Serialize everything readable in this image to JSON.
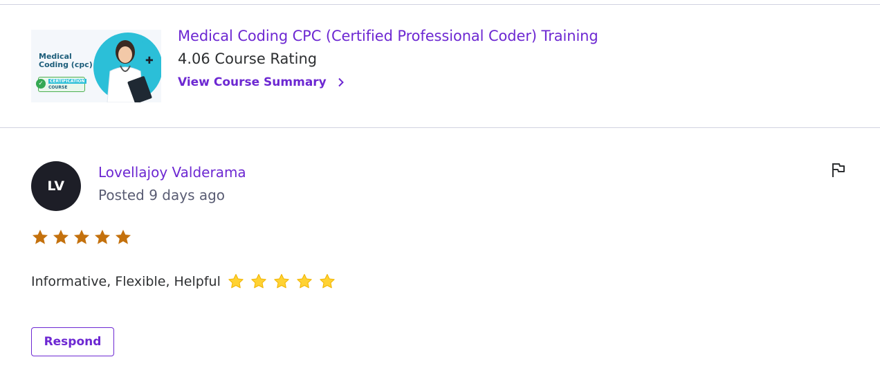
{
  "course": {
    "thumbnail": {
      "title_line1": "Medical",
      "title_line2": "Coding (cpc)",
      "badge_line1": "CERTIFICATION",
      "badge_line2": "COURSE"
    },
    "title": "Medical Coding CPC (Certified Professional Coder) Training",
    "rating_text": "4.06 Course Rating",
    "summary_link": "View Course Summary",
    "summary_icon": "chevron-right-icon"
  },
  "review": {
    "avatar_initials": "LV",
    "reviewer_name": "Lovellajoy Valderama",
    "posted": "Posted 9 days ago",
    "flag_icon": "flag-icon",
    "star_rating": 5,
    "star_max": 5,
    "text": "Informative, Flexible, Helpful",
    "emoji_stars": [
      "⭐",
      "⭐",
      "⭐",
      "⭐",
      "⭐"
    ],
    "respond_label": "Respond"
  },
  "colors": {
    "accent": "#6d28d2",
    "star": "#c4710d",
    "emoji_star": "#ffd233",
    "avatar_bg": "#1d1e27",
    "divider": "#d1d2e0"
  }
}
